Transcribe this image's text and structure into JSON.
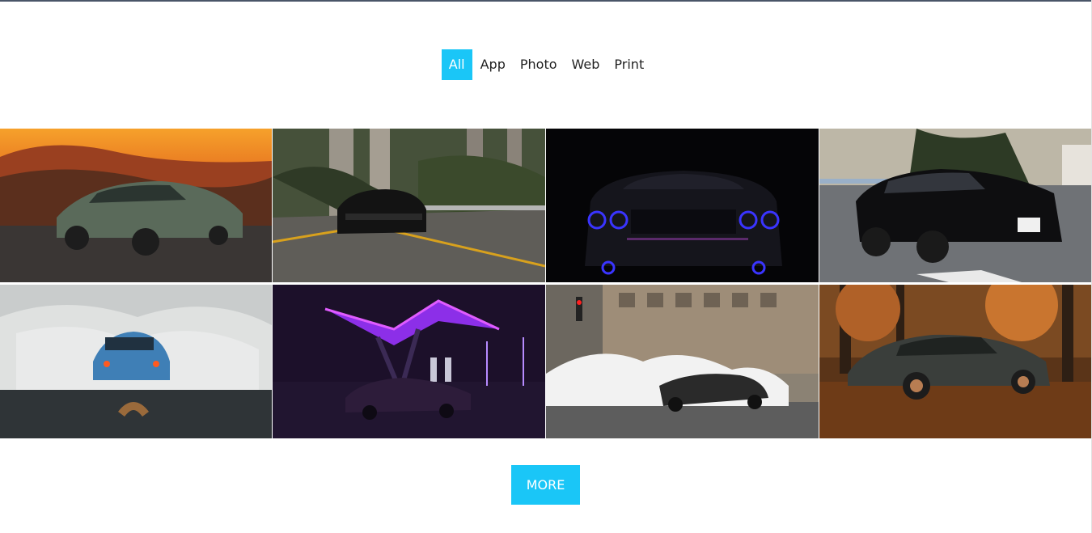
{
  "colors": {
    "accent": "#1ac6f7",
    "text": "#222222",
    "background": "#ffffff"
  },
  "filters": [
    {
      "label": "All",
      "active": true
    },
    {
      "label": "App",
      "active": false
    },
    {
      "label": "Photo",
      "active": false
    },
    {
      "label": "Web",
      "active": false
    },
    {
      "label": "Print",
      "active": false
    }
  ],
  "gallery": {
    "items": [
      {
        "subject": "green luxury coupe at sunset"
      },
      {
        "subject": "black sedan on highway ramp"
      },
      {
        "subject": "muscle car front with blue halo lights"
      },
      {
        "subject": "black sports car in parking lot"
      },
      {
        "subject": "blue muscle car doing burnout in smoke"
      },
      {
        "subject": "muscle car under neon gas station canopy"
      },
      {
        "subject": "drifting race car with tire smoke in city"
      },
      {
        "subject": "dark sedan among autumn leaves"
      }
    ]
  },
  "more_button": {
    "label": "MORE"
  }
}
